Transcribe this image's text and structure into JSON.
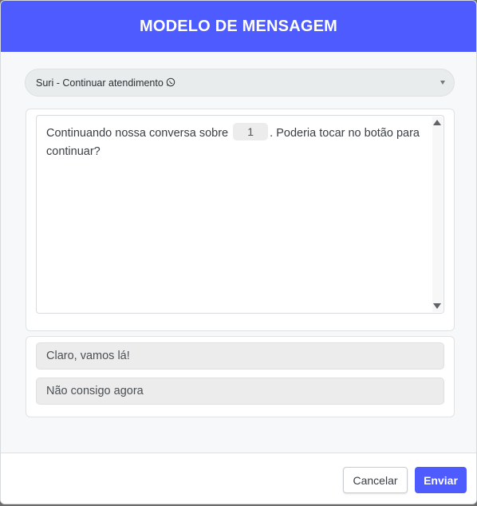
{
  "modal": {
    "title": "MODELO DE MENSAGEM"
  },
  "template_select": {
    "value": "Suri - Continuar atendimento",
    "icon": "whatsapp-icon"
  },
  "message": {
    "text_before": "Continuando nossa conversa sobre",
    "variable": "1",
    "text_after": ". Poderia tocar no botão para continuar?"
  },
  "quick_replies": [
    {
      "label": "Claro, vamos lá!"
    },
    {
      "label": "Não consigo agora"
    }
  ],
  "footer": {
    "cancel_label": "Cancelar",
    "send_label": "Enviar"
  },
  "colors": {
    "accent": "#4d5bff",
    "background": "#f6f8f9"
  }
}
